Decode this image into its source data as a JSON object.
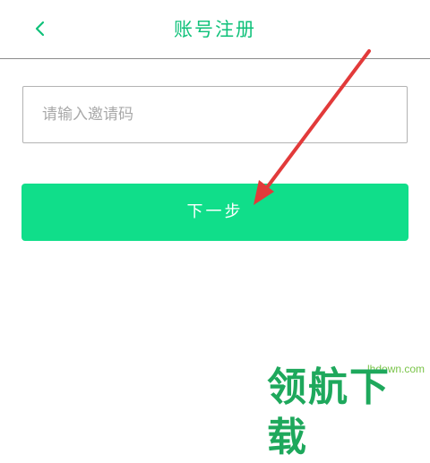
{
  "header": {
    "title": "账号注册",
    "back_icon": "chevron-left-icon"
  },
  "form": {
    "invite_code_placeholder": "请输入邀请码",
    "invite_code_value": ""
  },
  "actions": {
    "next_label": "下一步"
  },
  "watermark": {
    "url": "lhdown.com",
    "brand": "领航下载"
  },
  "colors": {
    "accent": "#10c17a",
    "button": "#10de8a",
    "arrow": "#e23a3a"
  }
}
